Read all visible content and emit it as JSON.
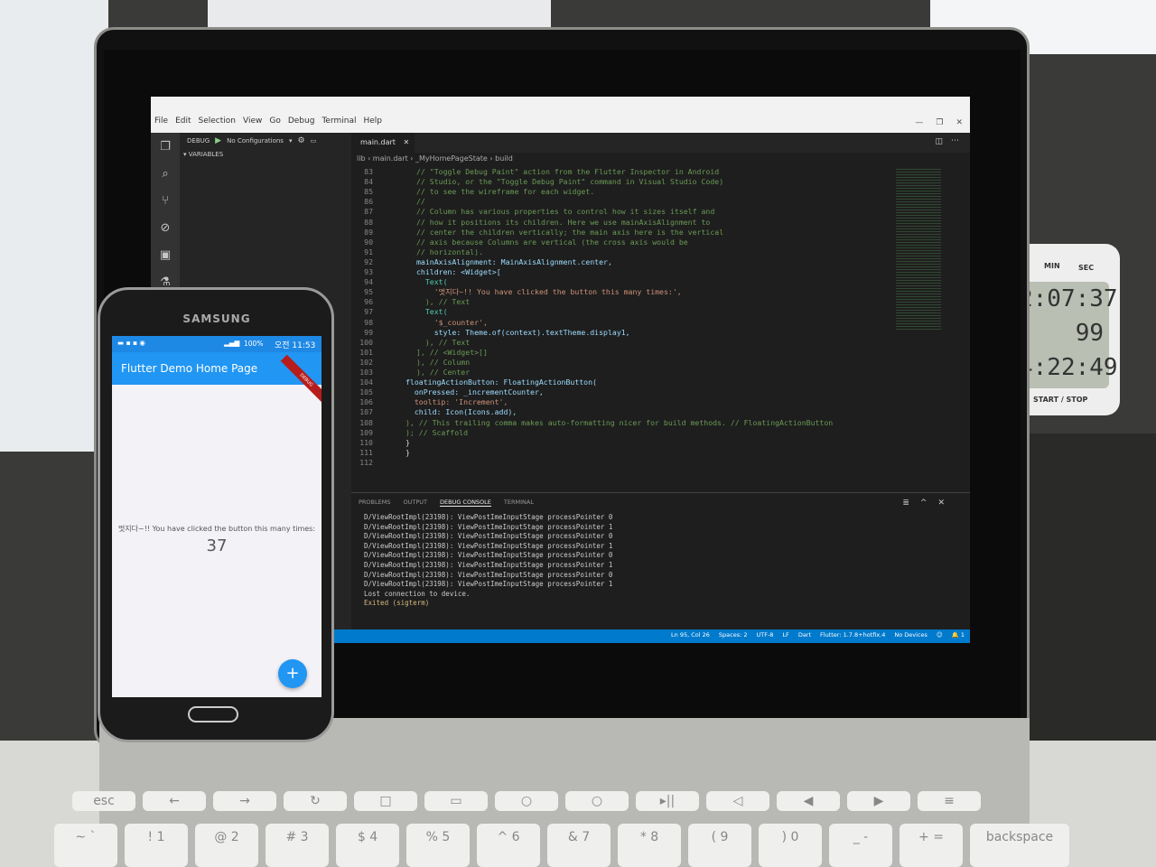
{
  "timer_display": [
    "2:07:37",
    "99",
    "4:22:49"
  ],
  "timer_labels": [
    "MIN",
    "SEC",
    "START / STOP"
  ],
  "keyboard_keys": [
    "esc",
    "←",
    "→",
    "↻",
    "□",
    "▭",
    "○",
    "○",
    "▸||",
    "◁",
    "◀",
    "▶",
    "≡",
    "~ `",
    "! 1",
    "@ 2",
    "# 3",
    "$ 4",
    "% 5",
    "^ 6",
    "& 7",
    "* 8",
    "( 9",
    ") 0",
    "_ -",
    "+ =",
    "backspace"
  ],
  "vscode": {
    "menu": [
      "File",
      "Edit",
      "Selection",
      "View",
      "Go",
      "Debug",
      "Terminal",
      "Help"
    ],
    "window_buttons": [
      "—",
      "❐",
      "✕"
    ],
    "debug_label": "DEBUG",
    "debug_config": "No Configurations",
    "variables_label": "VARIABLES",
    "tab_title": "main.dart",
    "breadcrumb": "lib › main.dart › _MyHomePageState › build",
    "code_lines": [
      {
        "n": "83",
        "t": "// \"Toggle Debug Paint\" action from the Flutter Inspector in Android",
        "c": "c-comment"
      },
      {
        "n": "84",
        "t": "// Studio, or the \"Toggle Debug Paint\" command in Visual Studio Code)",
        "c": "c-comment"
      },
      {
        "n": "85",
        "t": "// to see the wireframe for each widget.",
        "c": "c-comment"
      },
      {
        "n": "86",
        "t": "//",
        "c": "c-comment"
      },
      {
        "n": "87",
        "t": "// Column has various properties to control how it sizes itself and",
        "c": "c-comment"
      },
      {
        "n": "88",
        "t": "// how it positions its children. Here we use mainAxisAlignment to",
        "c": "c-comment"
      },
      {
        "n": "89",
        "t": "// center the children vertically; the main axis here is the vertical",
        "c": "c-comment"
      },
      {
        "n": "90",
        "t": "// axis because Columns are vertical (the cross axis would be",
        "c": "c-comment"
      },
      {
        "n": "91",
        "t": "// horizontal).",
        "c": "c-comment"
      },
      {
        "n": "92",
        "t": "mainAxisAlignment: MainAxisAlignment.center,",
        "c": "c-prop"
      },
      {
        "n": "93",
        "t": "children: <Widget>[",
        "c": "c-prop"
      },
      {
        "n": "94",
        "t": "  Text(",
        "c": "c-type"
      },
      {
        "n": "95",
        "t": "    '멋지다~!! You have clicked the button this many times:',",
        "c": "c-str"
      },
      {
        "n": "96",
        "t": "  ), // Text",
        "c": "c-comment"
      },
      {
        "n": "97",
        "t": "  Text(",
        "c": "c-type"
      },
      {
        "n": "98",
        "t": "    '$_counter',",
        "c": "c-str"
      },
      {
        "n": "99",
        "t": "    style: Theme.of(context).textTheme.display1,",
        "c": "c-prop"
      },
      {
        "n": "100",
        "t": "  ), // Text",
        "c": "c-comment"
      },
      {
        "n": "101",
        "t": "], // <Widget>[]",
        "c": "c-comment"
      },
      {
        "n": "102",
        "t": "), // Column",
        "c": "c-comment"
      },
      {
        "n": "103",
        "t": "), // Center",
        "c": "c-comment"
      },
      {
        "n": "104",
        "t": "floatingActionButton: FloatingActionButton(",
        "c": "c-prop"
      },
      {
        "n": "105",
        "t": "  onPressed: _incrementCounter,",
        "c": "c-prop"
      },
      {
        "n": "106",
        "t": "  tooltip: 'Increment',",
        "c": "c-str"
      },
      {
        "n": "107",
        "t": "  child: Icon(Icons.add),",
        "c": "c-prop"
      },
      {
        "n": "108",
        "t": "), // This trailing comma makes auto-formatting nicer for build methods. // FloatingActionButton",
        "c": "c-comment"
      },
      {
        "n": "109",
        "t": "); // Scaffold",
        "c": "c-comment"
      },
      {
        "n": "110",
        "t": "}",
        "c": "c-plain"
      },
      {
        "n": "111",
        "t": "}",
        "c": "c-plain"
      },
      {
        "n": "112",
        "t": "",
        "c": "c-plain"
      }
    ],
    "panel_tabs": [
      "PROBLEMS",
      "OUTPUT",
      "DEBUG CONSOLE",
      "TERMINAL"
    ],
    "panel_controls": [
      "≣",
      "^",
      "✕"
    ],
    "console_lines": [
      "D/ViewRootImpl(23198): ViewPostImeInputStage processPointer 0",
      "D/ViewRootImpl(23198): ViewPostImeInputStage processPointer 1",
      "D/ViewRootImpl(23198): ViewPostImeInputStage processPointer 0",
      "D/ViewRootImpl(23198): ViewPostImeInputStage processPointer 1",
      "D/ViewRootImpl(23198): ViewPostImeInputStage processPointer 0",
      "D/ViewRootImpl(23198): ViewPostImeInputStage processPointer 1",
      "D/ViewRootImpl(23198): ViewPostImeInputStage processPointer 0",
      "D/ViewRootImpl(23198): ViewPostImeInputStage processPointer 1",
      "Lost connection to device.",
      "Exited (sigterm)"
    ],
    "status_items": [
      "Ln 95, Col 26",
      "Spaces: 2",
      "UTF-8",
      "LF",
      "Dart",
      "Flutter: 1.7.8+hotfix.4",
      "No Devices",
      "☺",
      "🔔 1"
    ]
  },
  "phone": {
    "brand": "SAMSUNG",
    "status_battery": "100%",
    "status_time": "오전 11:53",
    "app_title": "Flutter Demo Home Page",
    "debug_ribbon": "DEBUG",
    "message": "멋지다~!! You have clicked the button this many times:",
    "counter": "37",
    "fab_icon": "+"
  }
}
